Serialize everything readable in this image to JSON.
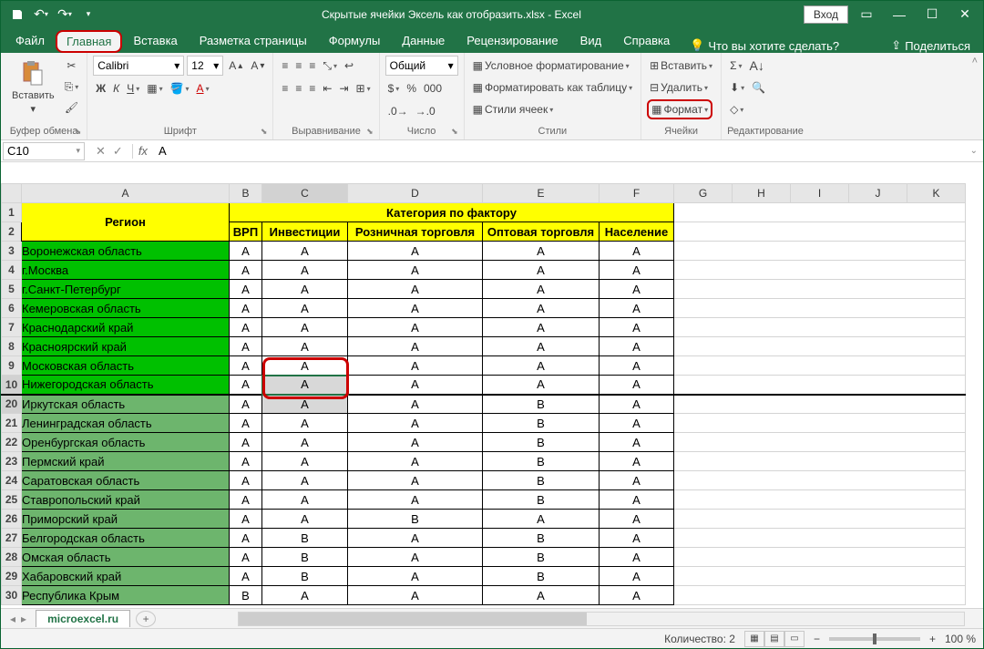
{
  "titlebar": {
    "title": "Скрытые ячейки Эксель как отобразить.xlsx - Excel",
    "account": "Вход"
  },
  "tabs": {
    "file": "Файл",
    "home": "Главная",
    "insert": "Вставка",
    "layout": "Разметка страницы",
    "formulas": "Формулы",
    "data": "Данные",
    "review": "Рецензирование",
    "view": "Вид",
    "help": "Справка",
    "tell": "Что вы хотите сделать?",
    "share": "Поделиться"
  },
  "ribbon": {
    "clipboard": {
      "paste": "Вставить",
      "label": "Буфер обмена"
    },
    "font": {
      "name": "Calibri",
      "size": "12",
      "label": "Шрифт",
      "bold": "Ж",
      "italic": "К",
      "underline": "Ч"
    },
    "align": {
      "label": "Выравнивание"
    },
    "number": {
      "format": "Общий",
      "label": "Число"
    },
    "styles": {
      "cond": "Условное форматирование",
      "table": "Форматировать как таблицу",
      "cell": "Стили ячеек",
      "label": "Стили"
    },
    "cells": {
      "insert": "Вставить",
      "delete": "Удалить",
      "format": "Формат",
      "label": "Ячейки"
    },
    "editing": {
      "label": "Редактирование"
    }
  },
  "fbar": {
    "ref": "C10",
    "val": "A"
  },
  "cols": [
    "A",
    "B",
    "C",
    "D",
    "E",
    "F",
    "G",
    "H",
    "I",
    "J",
    "K"
  ],
  "headers": {
    "merged": "Категория по фактору",
    "region": "Регион",
    "b": "ВРП",
    "c": "Инвестиции",
    "d": "Розничная торговля",
    "e": "Оптовая торговля",
    "f": "Население"
  },
  "rows": [
    {
      "n": 3,
      "r": "Воронежская область",
      "g": "bright",
      "v": [
        "A",
        "A",
        "A",
        "A",
        "A"
      ]
    },
    {
      "n": 4,
      "r": "г.Москва",
      "g": "bright",
      "v": [
        "A",
        "A",
        "A",
        "A",
        "A"
      ]
    },
    {
      "n": 5,
      "r": "г.Санкт-Петербург",
      "g": "bright",
      "v": [
        "A",
        "A",
        "A",
        "A",
        "A"
      ]
    },
    {
      "n": 6,
      "r": "Кемеровская область",
      "g": "bright",
      "v": [
        "A",
        "A",
        "A",
        "A",
        "A"
      ]
    },
    {
      "n": 7,
      "r": "Краснодарский край",
      "g": "bright",
      "v": [
        "A",
        "A",
        "A",
        "A",
        "A"
      ]
    },
    {
      "n": 8,
      "r": "Красноярский край",
      "g": "bright",
      "v": [
        "A",
        "A",
        "A",
        "A",
        "A"
      ]
    },
    {
      "n": 9,
      "r": "Московская область",
      "g": "bright",
      "v": [
        "A",
        "A",
        "A",
        "A",
        "A"
      ]
    },
    {
      "n": 10,
      "r": "Нижегородская область",
      "g": "bright",
      "v": [
        "A",
        "A",
        "A",
        "A",
        "A"
      ]
    },
    {
      "n": 20,
      "r": "Иркутская область",
      "g": "dark",
      "v": [
        "A",
        "A",
        "A",
        "B",
        "A"
      ]
    },
    {
      "n": 21,
      "r": "Ленинградская область",
      "g": "dark",
      "v": [
        "A",
        "A",
        "A",
        "B",
        "A"
      ]
    },
    {
      "n": 22,
      "r": "Оренбургская область",
      "g": "dark",
      "v": [
        "A",
        "A",
        "A",
        "B",
        "A"
      ]
    },
    {
      "n": 23,
      "r": "Пермский край",
      "g": "dark",
      "v": [
        "A",
        "A",
        "A",
        "B",
        "A"
      ]
    },
    {
      "n": 24,
      "r": "Саратовская область",
      "g": "dark",
      "v": [
        "A",
        "A",
        "A",
        "B",
        "A"
      ]
    },
    {
      "n": 25,
      "r": "Ставропольский край",
      "g": "dark",
      "v": [
        "A",
        "A",
        "A",
        "B",
        "A"
      ]
    },
    {
      "n": 26,
      "r": "Приморский край",
      "g": "dark",
      "v": [
        "A",
        "A",
        "B",
        "A",
        "A"
      ]
    },
    {
      "n": 27,
      "r": "Белгородская область",
      "g": "dark",
      "v": [
        "A",
        "B",
        "A",
        "B",
        "A"
      ]
    },
    {
      "n": 28,
      "r": "Омская область",
      "g": "dark",
      "v": [
        "A",
        "B",
        "A",
        "B",
        "A"
      ]
    },
    {
      "n": 29,
      "r": "Хабаровский край",
      "g": "dark",
      "v": [
        "A",
        "B",
        "A",
        "B",
        "A"
      ]
    },
    {
      "n": 30,
      "r": "Республика Крым",
      "g": "dark",
      "v": [
        "B",
        "A",
        "A",
        "A",
        "A"
      ]
    }
  ],
  "sheet": {
    "name": "microexcel.ru"
  },
  "status": {
    "count": "Количество: 2",
    "zoom": "100 %"
  }
}
